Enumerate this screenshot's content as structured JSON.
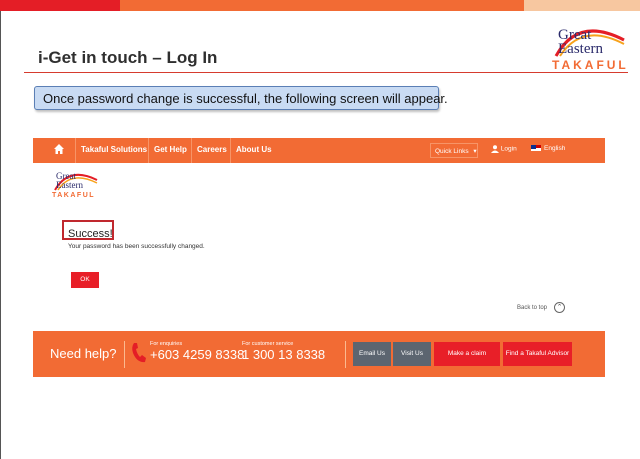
{
  "slide": {
    "title": "i-Get in touch – Log In",
    "callout": "Once password change is successful, the following screen will appear."
  },
  "logo": {
    "line1": "Great",
    "line2": "Eastern",
    "line3": "TAKAFUL"
  },
  "nav": {
    "items": [
      "Takaful Solutions",
      "Get Help",
      "Careers",
      "About Us"
    ],
    "quick_links": "Quick Links",
    "login": "Login",
    "language": "English"
  },
  "content": {
    "success_title": "Success!",
    "success_message": "Your password has been successfully changed.",
    "ok_label": "OK",
    "back_to_top": "Back to top"
  },
  "footer": {
    "need_help": "Need help?",
    "enquiries_label": "For enquiries",
    "enquiries_number": "+603 4259 8338",
    "customer_service_label": "For customer service",
    "customer_service_number": "1 300 13 8338",
    "buttons": [
      "Email Us",
      "Visit Us",
      "Make a claim",
      "Find a Takaful Advisor"
    ]
  },
  "colors": {
    "brand_orange": "#f26b34",
    "brand_red": "#e81f28",
    "navy": "#2b2b6b"
  }
}
